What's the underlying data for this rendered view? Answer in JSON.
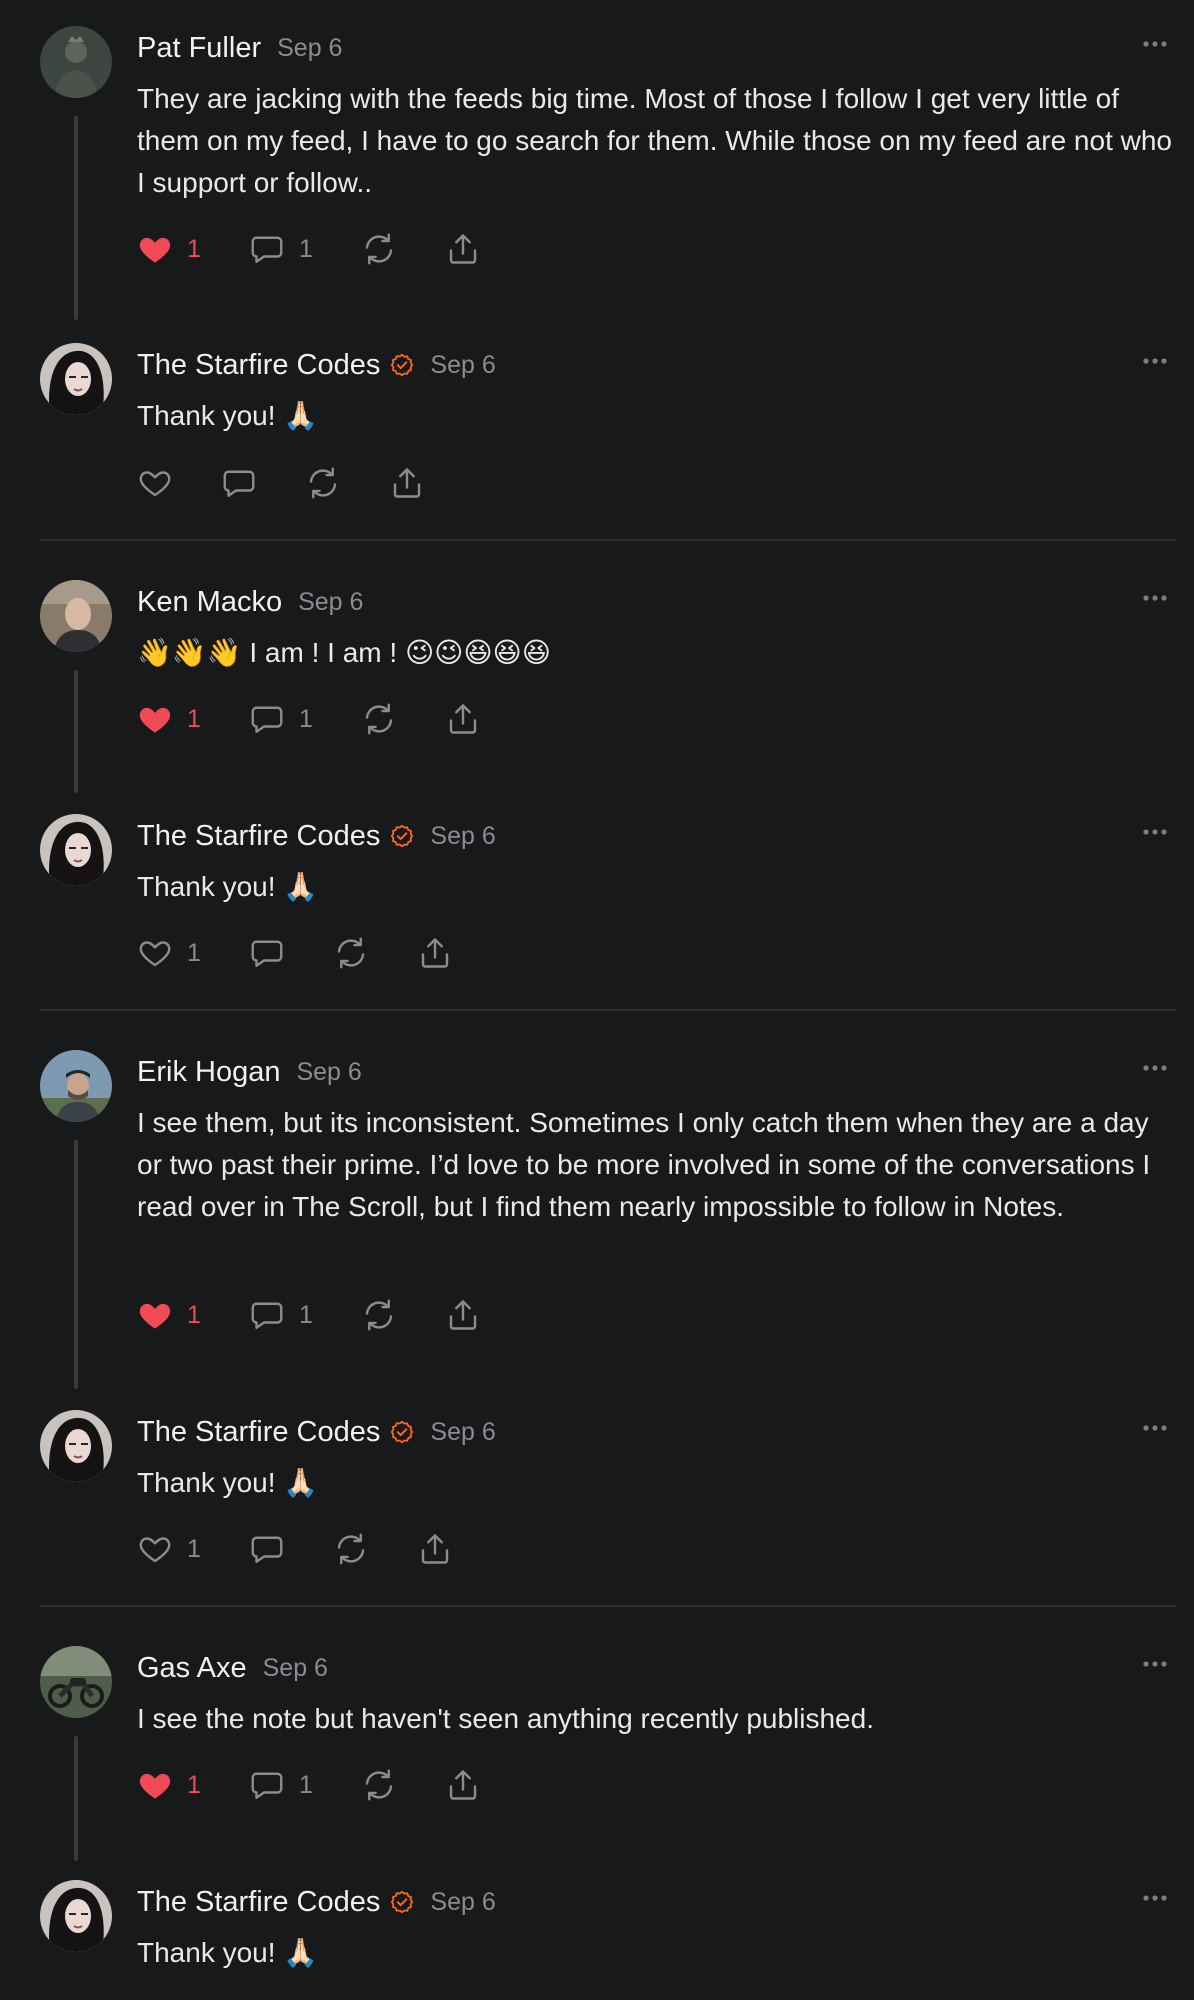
{
  "colors": {
    "background": "#18191b",
    "text": "#ececec",
    "muted": "#8b8c90",
    "like_active": "#ef4a56",
    "verified_badge": "#ff6719",
    "thread_line": "#3a3b3e"
  },
  "icons": {
    "like": "heart-icon",
    "comment": "comment-bubble-icon",
    "restack": "restack-icon",
    "share": "share-icon",
    "more": "more-dots-icon",
    "verified": "verified-badge-icon"
  },
  "notes": [
    {
      "author": "Pat Fuller",
      "verified": false,
      "date": "Sep 6",
      "text": "They are jacking with the feeds big time. Most of those I follow I get very little of them on my feed, I have to go search for them. While those on my feed are not who I support or follow..",
      "liked": true,
      "likes": "1",
      "comments": "1"
    },
    {
      "author": "The Starfire Codes",
      "verified": true,
      "date": "Sep 6",
      "text": "Thank you! 🙏🏻",
      "liked": false,
      "likes": "",
      "comments": ""
    },
    {
      "author": "Ken Macko",
      "verified": false,
      "date": "Sep 6",
      "text": "👋👋👋 I am ! I am ! 😉😉😆😆😆",
      "liked": true,
      "likes": "1",
      "comments": "1"
    },
    {
      "author": "The Starfire Codes",
      "verified": true,
      "date": "Sep 6",
      "text": "Thank you! 🙏🏻",
      "liked": false,
      "likes": "1",
      "comments": ""
    },
    {
      "author": "Erik Hogan",
      "verified": false,
      "date": "Sep 6",
      "text": "I see them, but its inconsistent. Sometimes I only catch them when they are a day or two past their prime. I’d love to be more involved in some of the conversations I read over in The Scroll, but I find them nearly impossible to follow in Notes.",
      "liked": true,
      "likes": "1",
      "comments": "1"
    },
    {
      "author": "The Starfire Codes",
      "verified": true,
      "date": "Sep 6",
      "text": "Thank you! 🙏🏻",
      "liked": false,
      "likes": "1",
      "comments": ""
    },
    {
      "author": "Gas Axe",
      "verified": false,
      "date": "Sep 6",
      "text": "I see the note but haven't seen anything recently published.",
      "liked": true,
      "likes": "1",
      "comments": "1"
    },
    {
      "author": "The Starfire Codes",
      "verified": true,
      "date": "Sep 6",
      "text": "Thank you! 🙏🏻",
      "liked": false,
      "likes": "",
      "comments": ""
    }
  ]
}
